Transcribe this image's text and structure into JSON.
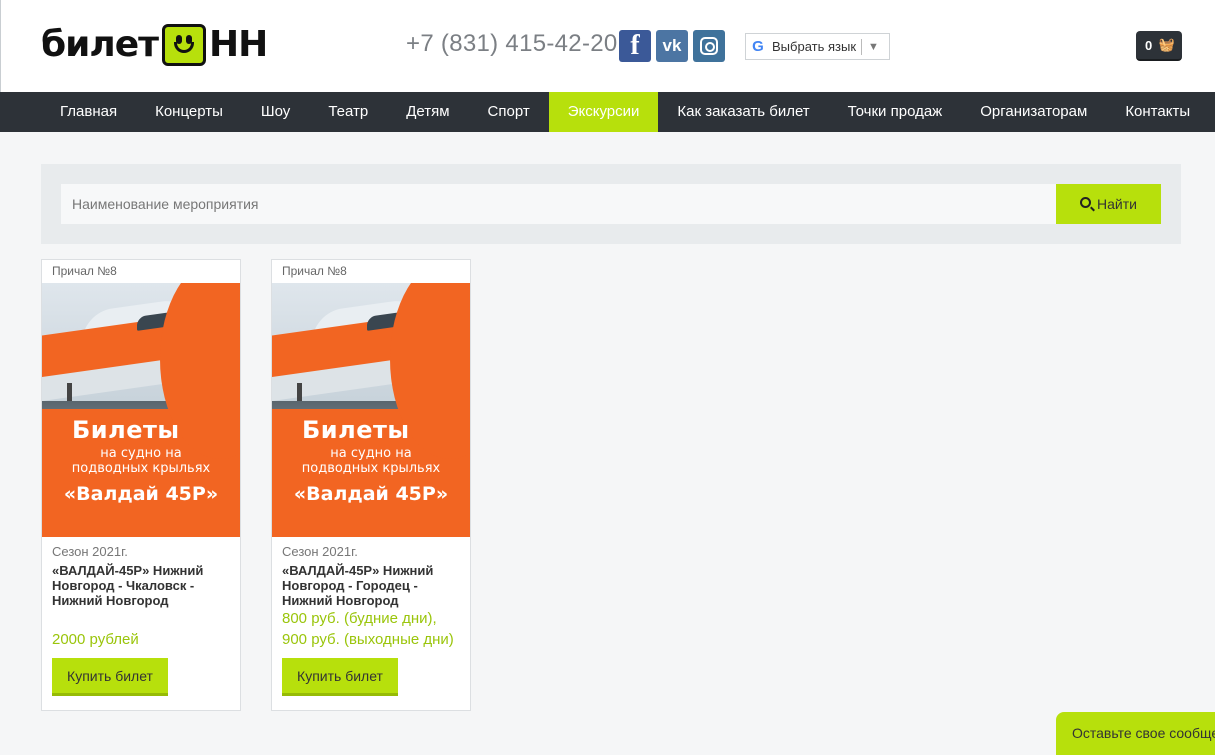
{
  "header": {
    "logo": {
      "word_left": "билет",
      "word_right": "НН"
    },
    "phone": "+7 (831) 415-42-20",
    "social": [
      {
        "name": "facebook",
        "glyph": "f"
      },
      {
        "name": "vkontakte",
        "glyph": "vk"
      },
      {
        "name": "instagram",
        "glyph": ""
      }
    ],
    "translate": {
      "label": "Выбрать язык",
      "icon": "G"
    },
    "cart": {
      "count": "0"
    }
  },
  "nav": {
    "items": [
      {
        "label": "Главная",
        "active": false
      },
      {
        "label": "Концерты",
        "active": false
      },
      {
        "label": "Шоу",
        "active": false
      },
      {
        "label": "Театр",
        "active": false
      },
      {
        "label": "Детям",
        "active": false
      },
      {
        "label": "Спорт",
        "active": false
      },
      {
        "label": "Экскурсии",
        "active": true
      },
      {
        "label": "Как заказать билет",
        "active": false
      },
      {
        "label": "Точки продаж",
        "active": false
      },
      {
        "label": "Организаторам",
        "active": false
      },
      {
        "label": "Контакты",
        "active": false
      }
    ]
  },
  "search": {
    "placeholder": "Наименование мероприятия",
    "button_label": "Найти"
  },
  "cards": [
    {
      "venue": "Причал №8",
      "poster": {
        "title": "Билеты",
        "subtitle_line1": "на судно на",
        "subtitle_line2": "подводных крыльях",
        "name": "«Валдай 45Р»"
      },
      "season": "Сезон 2021г.",
      "title": "«ВАЛДАЙ-45Р» Нижний Новгород - Чкаловск - Нижний Новгород",
      "price_line1": "2000 рублей",
      "price_line2": "",
      "buy_label": "Купить билет"
    },
    {
      "venue": "Причал №8",
      "poster": {
        "title": "Билеты",
        "subtitle_line1": "на судно на",
        "subtitle_line2": "подводных крыльях",
        "name": "«Валдай 45Р»"
      },
      "season": "Сезон 2021г.",
      "title": "«ВАЛДАЙ-45Р» Нижний Новгород - Городец - Нижний Новгород",
      "price_line1": "800 руб. (будние дни),",
      "price_line2": "900 руб. (выходные дни)",
      "buy_label": "Купить билет"
    }
  ],
  "message_widget": {
    "label": "Оставьте свое сообщение"
  },
  "colors": {
    "accent": "#b7e00c",
    "nav_bg": "#2d3238",
    "poster_orange": "#f26522",
    "price": "#9ac50b"
  }
}
